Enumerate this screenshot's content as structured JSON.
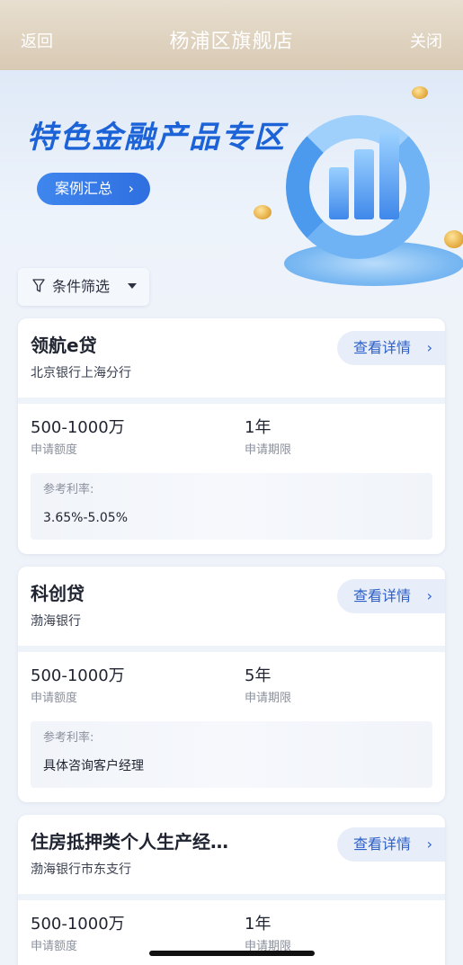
{
  "header": {
    "back_label": "返回",
    "title": "杨浦区旗舰店",
    "close_label": "关闭"
  },
  "banner": {
    "title": "特色金融产品专区",
    "case_button_label": "案例汇总",
    "case_button_chevron": "›"
  },
  "filter": {
    "label": "条件筛选"
  },
  "products": [
    {
      "name": "领航e贷",
      "bank": "北京银行上海分行",
      "detail_label": "查看详情",
      "amount": "500-1000万",
      "amount_label": "申请额度",
      "term": "1年",
      "term_label": "申请期限",
      "rate_label": "参考利率:",
      "rate_value": "3.65%-5.05%"
    },
    {
      "name": "科创贷",
      "bank": "渤海银行",
      "detail_label": "查看详情",
      "amount": "500-1000万",
      "amount_label": "申请额度",
      "term": "5年",
      "term_label": "申请期限",
      "rate_label": "参考利率:",
      "rate_value": "具体咨询客户经理"
    },
    {
      "name": "住房抵押类个人生产经…",
      "bank": "渤海银行市东支行",
      "detail_label": "查看详情",
      "amount": "500-1000万",
      "amount_label": "申请额度",
      "term": "1年",
      "term_label": "申请期限"
    }
  ],
  "colors": {
    "header_bg": "#d8c9b3",
    "accent_blue": "#1d63d8",
    "detail_button_bg": "#e8eef9",
    "page_bg": "#eef2f9"
  },
  "icons": {
    "filter": "funnel-icon",
    "filter_dropdown": "caret-down-icon",
    "detail_chevron": "chevron-right-icon"
  }
}
